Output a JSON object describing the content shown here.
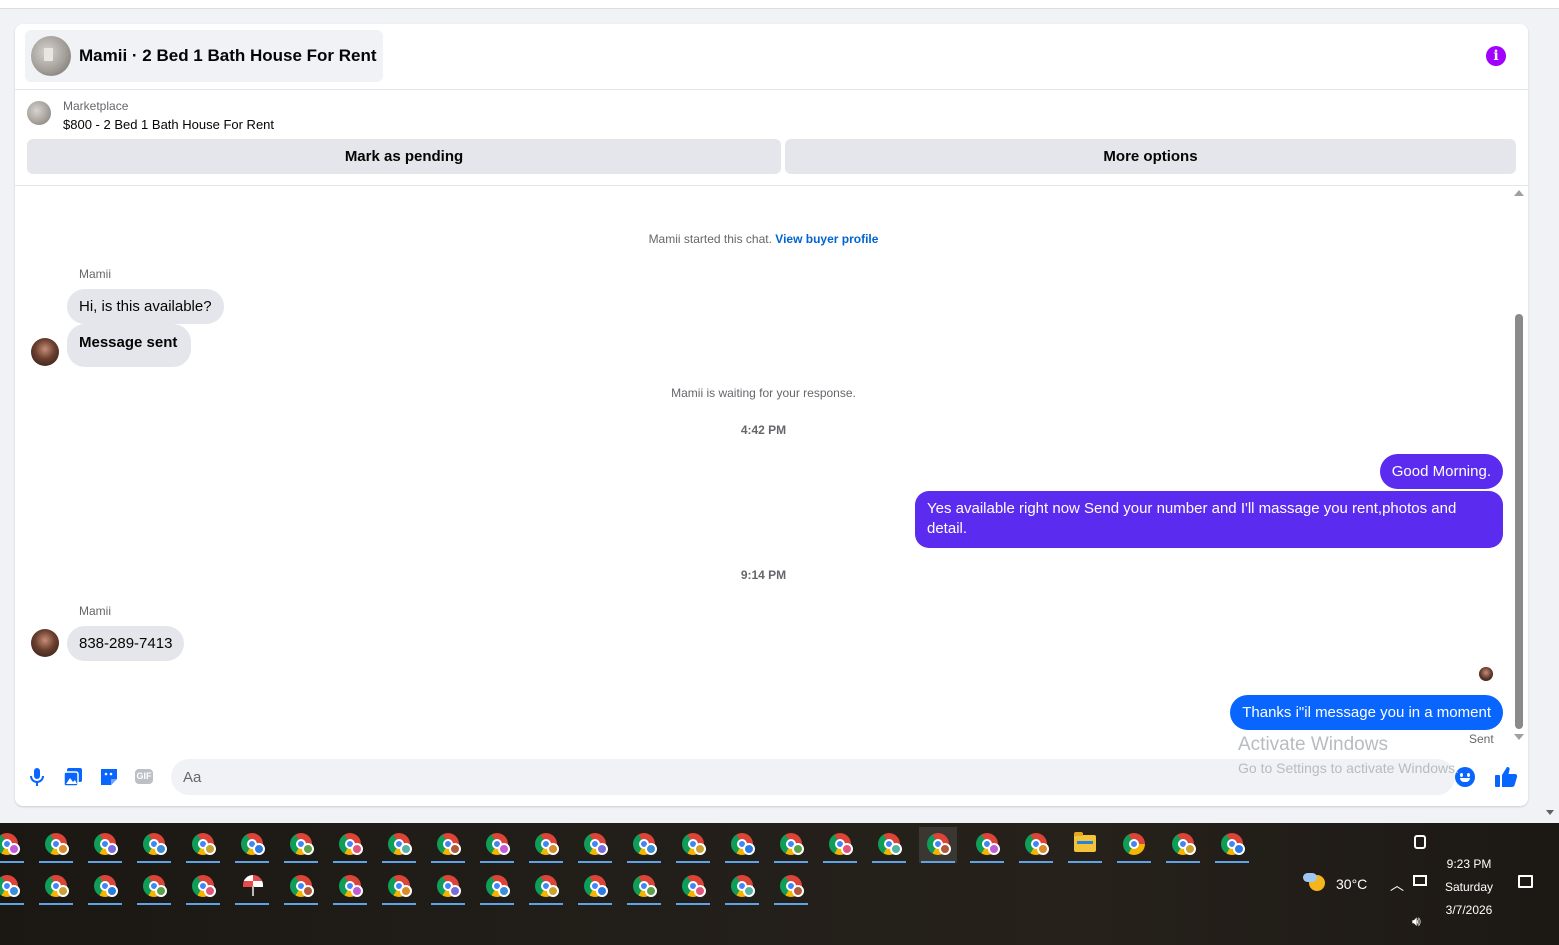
{
  "header": {
    "title": "Mamii · 2 Bed 1 Bath House For Rent",
    "info_icon": "info-icon"
  },
  "listing": {
    "source": "Marketplace",
    "price_title": "$800 - 2 Bed 1 Bath House For Rent",
    "mark_pending_label": "Mark as pending",
    "more_options_label": "More options"
  },
  "thread": {
    "system_start": "Mamii started this chat.",
    "view_profile_link": "View buyer profile",
    "waiting_text": "Mamii is waiting for your response.",
    "messages": [
      {
        "sender": "Mamii",
        "text": "Hi, is this available?",
        "direction": "in"
      },
      {
        "text": "Message sent",
        "direction": "in"
      },
      {
        "time": "4:42 PM"
      },
      {
        "text": "Good Morning.",
        "direction": "out"
      },
      {
        "text": "Yes available right now Send your number and I'll massage you rent,photos and detail.",
        "direction": "out"
      },
      {
        "time": "9:14 PM"
      },
      {
        "sender": "Mamii",
        "text": "838-289-7413",
        "direction": "in"
      },
      {
        "text": "Thanks i\"il message you in a moment",
        "direction": "out"
      }
    ],
    "sent_status": "Sent"
  },
  "composer": {
    "placeholder": "Aa",
    "icons": [
      "microphone-icon",
      "photo-icon",
      "sticker-icon",
      "gif-icon",
      "emoji-icon",
      "thumbs-up-icon"
    ],
    "gif_label": "GIF"
  },
  "watermark": {
    "line1": "Activate Windows",
    "line2": "Go to Settings to activate Windows."
  },
  "taskbar": {
    "weather_temp": "30°C",
    "time": "9:23 PM",
    "day": "Saturday",
    "date": "3/7/2026"
  },
  "colors": {
    "accent_blue": "#0866ff",
    "bubble_purple": "#5b2bf0",
    "info_purple": "#a100ff",
    "bubble_gray": "#e4e6eb"
  }
}
